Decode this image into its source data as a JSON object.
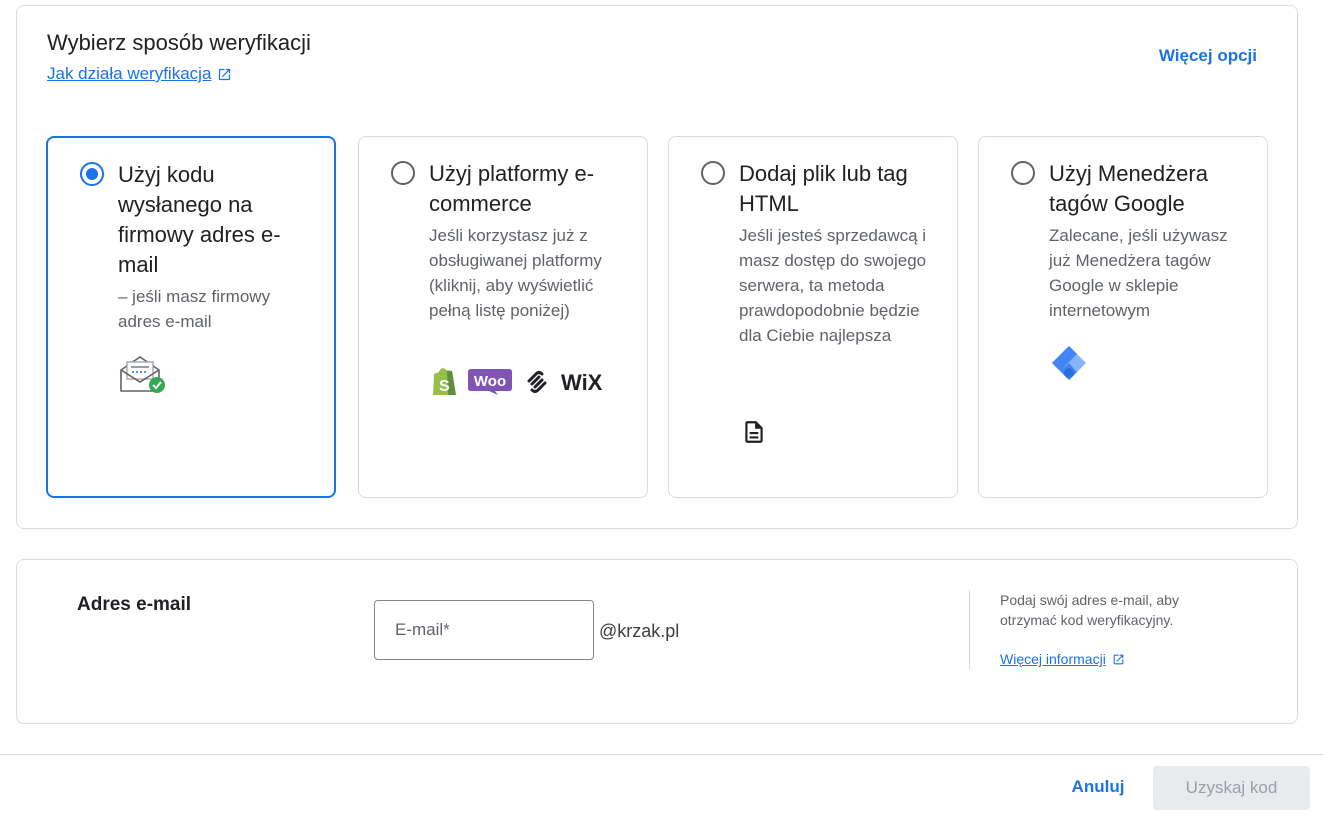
{
  "header": {
    "title": "Wybierz sposób weryfikacji",
    "help_link": "Jak działa weryfikacja",
    "more_options": "Więcej opcji"
  },
  "options": [
    {
      "title": "Użyj kodu wysłanego na firmowy adres e-mail",
      "description": "– jeśli masz firmowy adres e-mail",
      "selected": true,
      "icon": "email-verified-icon"
    },
    {
      "title": "Użyj platformy e-commerce",
      "description": "Jeśli korzystasz już z obsługiwanej platformy (kliknij, aby wyświetlić pełną listę poniżej)",
      "selected": false,
      "icons": [
        "shopify-icon",
        "woocommerce-icon",
        "squarespace-icon",
        "wix-icon"
      ],
      "wix_text": "WiX",
      "woo_text": "Woo"
    },
    {
      "title": "Dodaj plik lub tag HTML",
      "description": "Jeśli jesteś sprzedawcą i masz dostęp do swojego serwera, ta metoda prawdopodobnie będzie dla Ciebie najlepsza",
      "selected": false,
      "icon": "document-icon"
    },
    {
      "title": "Użyj Menedżera tagów Google",
      "description": "Zalecane, jeśli używasz już Menedżera tagów Google w sklepie internetowym",
      "selected": false,
      "icon": "google-tag-manager-icon"
    }
  ],
  "email_section": {
    "label": "Adres e-mail",
    "placeholder": "E-mail*",
    "domain": "@krzak.pl",
    "hint": "Podaj swój adres e-mail, aby otrzymać kod weryfikacyjny.",
    "more_info": "Więcej informacji"
  },
  "footer": {
    "cancel": "Anuluj",
    "get_code": "Uzyskaj kod"
  },
  "colors": {
    "accent": "#1a73e8",
    "border": "#dadce0",
    "disabled_bg": "#e8eaed"
  }
}
